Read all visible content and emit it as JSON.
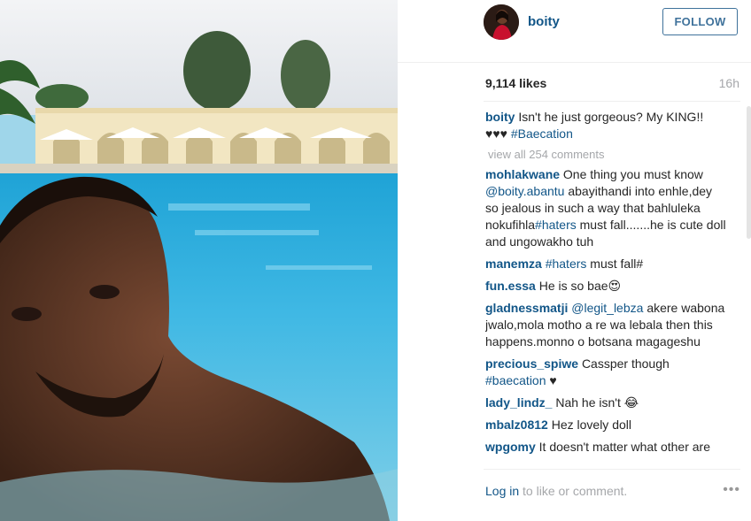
{
  "post": {
    "author": "boity",
    "follow_label": "FOLLOW",
    "likes": "9,114 likes",
    "time": "16h",
    "caption": {
      "user": "boity",
      "text": "Isn't he just gorgeous? My KING!! ♥♥♥",
      "hashtag": "#Baecation"
    },
    "view_all": "view all 254 comments"
  },
  "comments": [
    {
      "user": "mohlakwane",
      "text_a": "One thing you must know",
      "mention": "@boity.abantu",
      "text_b": "abayithandi into enhle,dey so jealous in such a way that bahluleka nokufihla",
      "hashtag": "#haters",
      "text_c": "must fall.......he is cute doll and ungowakho tuh"
    },
    {
      "user": "manemza",
      "hashtag": "#haters",
      "text": "must fall#"
    },
    {
      "user": "fun.essa",
      "text": "He is so bae😍"
    },
    {
      "user": "gladnessmatji",
      "mention": "@legit_lebza",
      "text": "akere wabona jwalo,mola motho a re wa lebala then this happens.monno o botsana magageshu"
    },
    {
      "user": "precious_spiwe",
      "text": "Cassper though",
      "hashtag": "#baecation",
      "text_b": "♥"
    },
    {
      "user": "lady_lindz_",
      "text": "Nah he isn't 😂"
    },
    {
      "user": "mbalz0812",
      "text": "Hez lovely doll"
    },
    {
      "user": "wpgomy",
      "text": "It doesn't matter what other are"
    }
  ],
  "footer": {
    "login_link": "Log in",
    "login_text": "to like or comment.",
    "more_label": "•••"
  }
}
